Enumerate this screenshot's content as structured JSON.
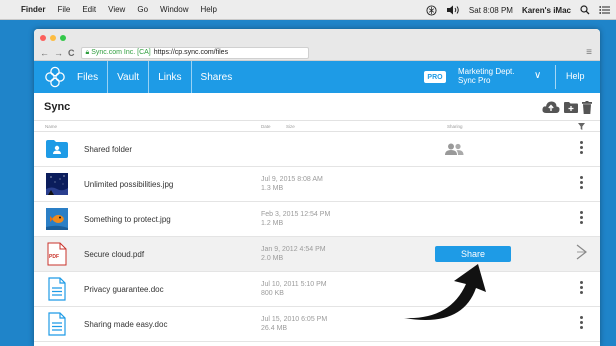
{
  "menubar": {
    "app": "Finder",
    "items": [
      "File",
      "Edit",
      "View",
      "Go",
      "Window",
      "Help"
    ],
    "clock": "Sat 8:08 PM",
    "computer": "Karen's iMac"
  },
  "browser": {
    "site_label": "Sync.com Inc. [CA]",
    "url": "https://cp.sync.com/files"
  },
  "appnav": {
    "items": [
      "Files",
      "Vault",
      "Links",
      "Shares"
    ],
    "pro_badge": "PRO",
    "account_line1": "Marketing Dept.",
    "account_line2": "Sync Pro",
    "help": "Help"
  },
  "page": {
    "title": "Sync",
    "col_name": "Name",
    "col_date": "Date",
    "col_size": "Size",
    "col_sharing": "Sharing"
  },
  "files": [
    {
      "name": "Shared folder",
      "date": "",
      "size": ""
    },
    {
      "name": "Unlimited possibilities.jpg",
      "date": "Jul 9, 2015 8:08 AM",
      "size": "1.3 MB"
    },
    {
      "name": "Something to protect.jpg",
      "date": "Feb 3, 2015 12:54 PM",
      "size": "1.2 MB"
    },
    {
      "name": "Secure cloud.pdf",
      "date": "Jan 9, 2012 4:54 PM",
      "size": "2.0 MB"
    },
    {
      "name": "Privacy guarantee.doc",
      "date": "Jul 10, 2011 5:10 PM",
      "size": "800 KB"
    },
    {
      "name": "Sharing made easy.doc",
      "date": "Jul 15, 2010 6:05 PM",
      "size": "26.4 MB"
    }
  ],
  "share_button": "Share",
  "pdf_icon_label": "PDF",
  "colors": {
    "background": "#1f84c9",
    "accent": "#1e9be6",
    "selected_row": "#f1f1f1"
  }
}
